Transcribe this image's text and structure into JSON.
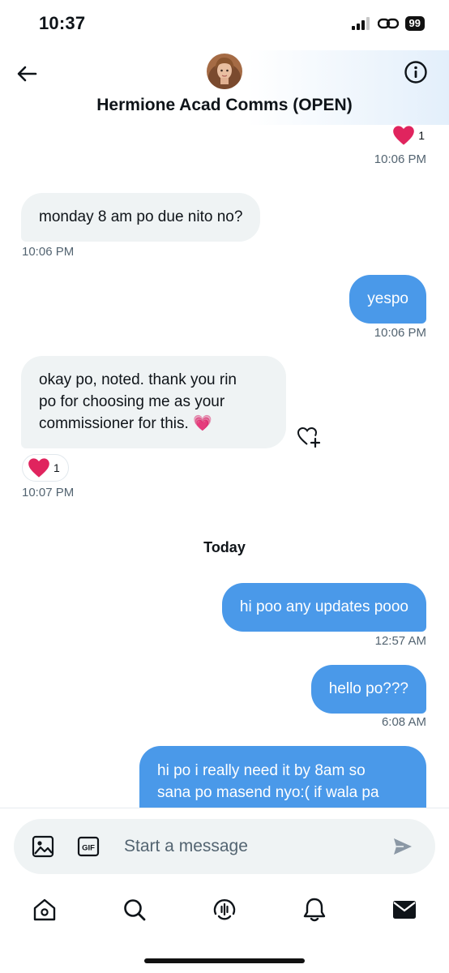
{
  "status_bar": {
    "time": "10:37",
    "battery": "99"
  },
  "header": {
    "title": "Hermione Acad Comms (OPEN)"
  },
  "messages": [
    {
      "id": "m0",
      "direction": "outgoing",
      "text": "",
      "time": "10:06 PM",
      "reaction": {
        "emoji": "heart",
        "count": "1"
      }
    },
    {
      "id": "m1",
      "direction": "incoming",
      "text": "monday 8 am po due nito no?",
      "time": "10:06 PM"
    },
    {
      "id": "m2",
      "direction": "outgoing",
      "text": "yespo",
      "time": "10:06 PM"
    },
    {
      "id": "m3",
      "direction": "incoming",
      "lines": [
        "okay po, noted. thank you rin",
        "po for choosing me as your",
        "commissioner for this. 💗"
      ],
      "time": "10:07 PM",
      "reaction": {
        "emoji": "heart",
        "count": "1"
      }
    },
    {
      "id": "m4",
      "direction": "outgoing",
      "text": "hi poo any updates pooo",
      "time": "12:57 AM"
    },
    {
      "id": "m5",
      "direction": "outgoing",
      "text": "hello po???",
      "time": "6:08 AM"
    },
    {
      "id": "m6",
      "direction": "outgoing",
      "lines": [
        "hi po i really need it by 8am so",
        "sana po masend nyo:( if wala pa"
      ]
    }
  ],
  "day_separator": "Today",
  "composer": {
    "placeholder": "Start a message",
    "gif_label": "GIF"
  },
  "nav": [
    "home-icon",
    "search-icon",
    "spaces-icon",
    "notifications-icon",
    "messages-icon"
  ],
  "colors": {
    "accent": "#1d9bf0",
    "outgoing_bubble": "#4a99e9",
    "incoming_bubble": "#eff3f4",
    "heart": "#e0245e"
  }
}
